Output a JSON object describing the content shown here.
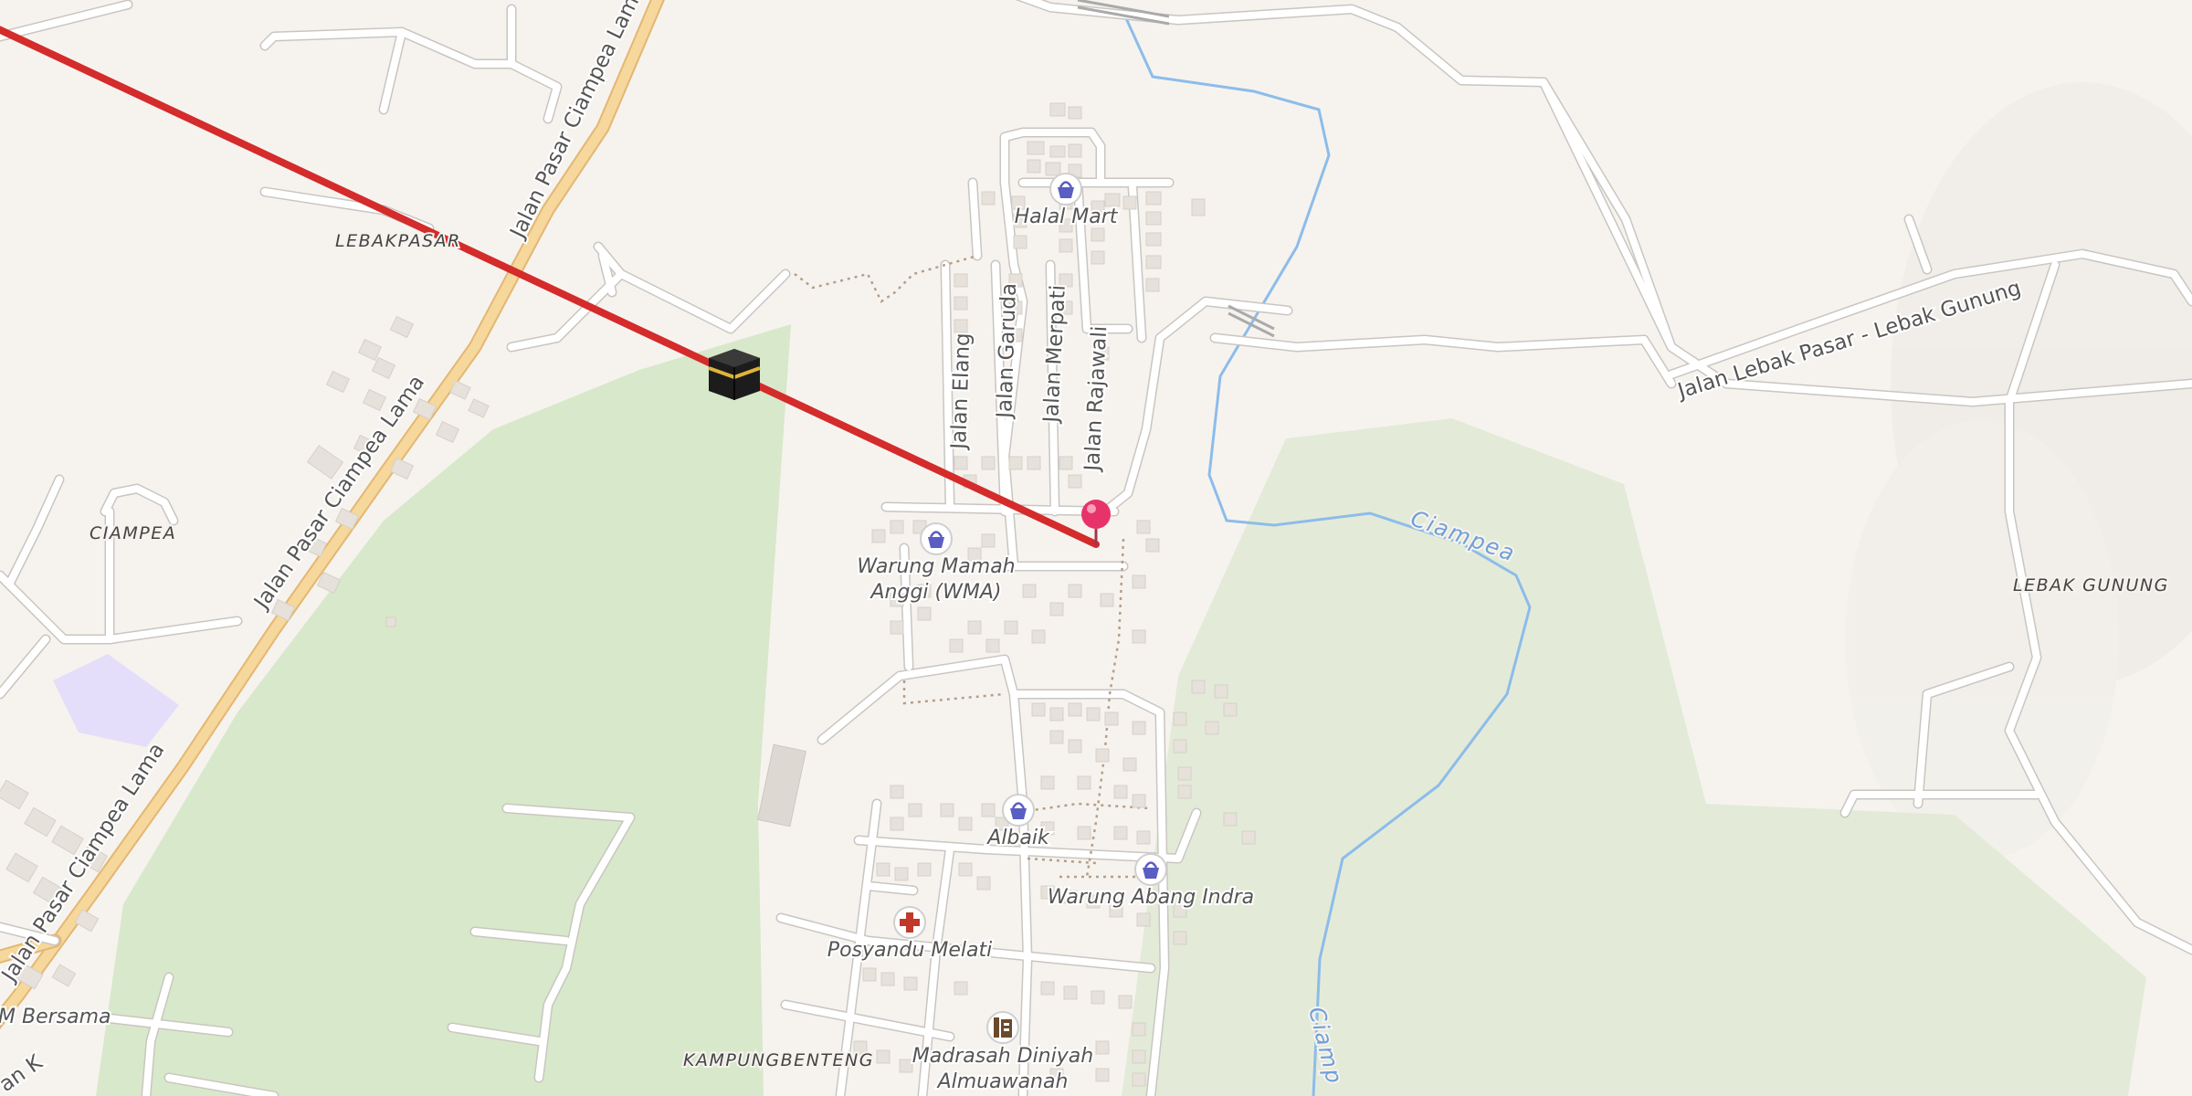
{
  "place_labels": {
    "lebakpasar": "LEBAKPASAR",
    "ciampea": "CIAMPEA",
    "lebak_gunung": "LEBAK GUNUNG",
    "kampungbenteng": "KAMPUNGBENTENG"
  },
  "road_labels": {
    "pasar_ciampea_lama_1": "Jalan Pasar Ciampea Lama",
    "pasar_ciampea_lama_2": "Jalan Pasar Ciampea Lama",
    "pasar_ciampea_lama_3": "Jalan Pasar Ciampea Lama",
    "lebak_pasar_gunung": "Jalan Lebak Pasar - Lebak Gunung",
    "elang": "Jalan Elang",
    "garuda": "Jalan Garuda",
    "merpati": "Jalan Merpati",
    "rajawali": "Jalan Rajawali"
  },
  "river_labels": {
    "ciampea_1": "Ciampea",
    "ciampea_2": "Ciamp"
  },
  "pois": {
    "halal_mart": "Halal Mart",
    "warung_mamah_1": "Warung Mamah",
    "warung_mamah_2": "Anggi (WMA)",
    "albaik": "Albaik",
    "warung_abang_indra": "Warung Abang Indra",
    "posyandu": "Posyandu Melati",
    "madrasah_1": "Madrasah Diniyah",
    "madrasah_2": "Almuawanah",
    "bersama": "M Bersama",
    "cut_bottom_left": "an K"
  },
  "icons": {
    "shop": "shopping-basket-icon",
    "clinic": "red-cross-icon",
    "school": "school-icon",
    "kaaba": "kaaba-icon",
    "pin": "location-pin-icon"
  },
  "colors": {
    "qibla_line": "#d42b2b",
    "pin": "#e8336a",
    "park": "#d9e8cb",
    "forest": "#e4ead9",
    "main_road": "#f6d79c",
    "water": "#8dbcea",
    "poi_icon": "#5a5dc2",
    "clinic_icon": "#c0392b"
  }
}
